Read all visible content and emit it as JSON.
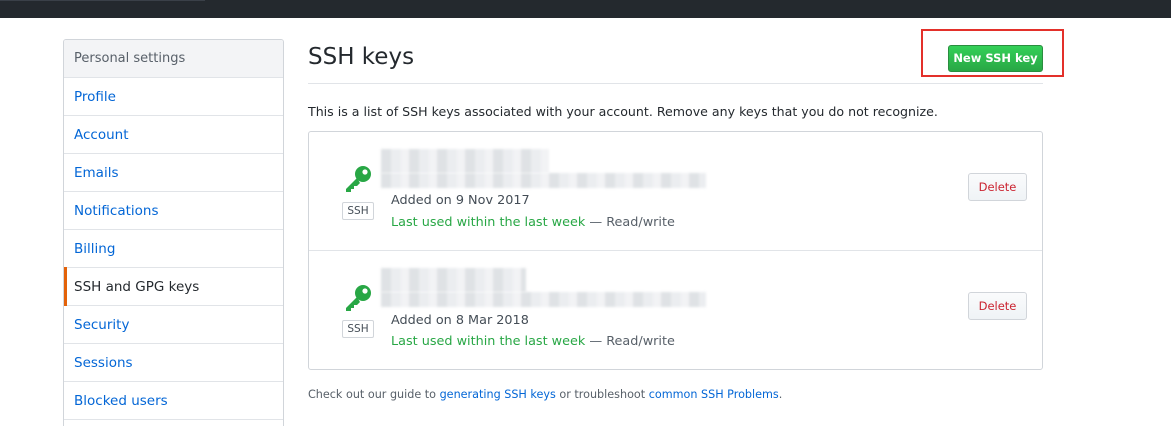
{
  "sidebar": {
    "header": "Personal settings",
    "items": [
      {
        "label": "Profile"
      },
      {
        "label": "Account"
      },
      {
        "label": "Emails"
      },
      {
        "label": "Notifications"
      },
      {
        "label": "Billing"
      },
      {
        "label": "SSH and GPG keys",
        "selected": true
      },
      {
        "label": "Security"
      },
      {
        "label": "Sessions"
      },
      {
        "label": "Blocked users"
      }
    ]
  },
  "main": {
    "title": "SSH keys",
    "new_key_label": "New SSH key",
    "intro": "This is a list of SSH keys associated with your account. Remove any keys that you do not recognize.",
    "keys": [
      {
        "badge": "SSH",
        "added": "Added on 9 Nov 2017",
        "last_used": "Last used within the last week",
        "access": " — Read/write",
        "delete_label": "Delete"
      },
      {
        "badge": "SSH",
        "added": "Added on 8 Mar 2018",
        "last_used": "Last used within the last week",
        "access": " — Read/write",
        "delete_label": "Delete"
      }
    ],
    "guide": {
      "prefix": "Check out our guide to ",
      "link1": "generating SSH keys",
      "middle": " or troubleshoot ",
      "link2": "common SSH Problems",
      "suffix": "."
    }
  },
  "colors": {
    "accent_green": "#28a745",
    "link_blue": "#0366d6",
    "danger_red": "#cb2431",
    "selected_bar": "#e36209",
    "highlight_red": "#e3302a"
  },
  "icons": [
    "key-icon"
  ]
}
